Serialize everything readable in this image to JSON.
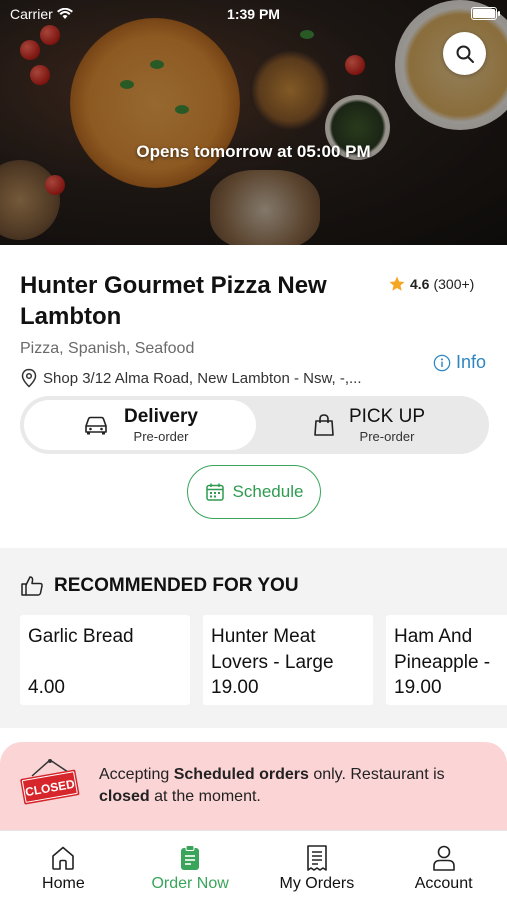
{
  "status_bar": {
    "carrier": "Carrier",
    "time": "1:39 PM"
  },
  "hero": {
    "opening_notice": "Opens tomorrow at 05:00 PM"
  },
  "restaurant": {
    "name": "Hunter Gourmet Pizza New Lambton",
    "rating": "4.6",
    "rating_count": "(300+)",
    "cuisines": "Pizza, Spanish, Seafood",
    "address": "Shop 3/12 Alma Road, New Lambton - Nsw, -,...",
    "info_label": "Info"
  },
  "order_type": {
    "options": [
      {
        "label": "Delivery",
        "sub": "Pre-order",
        "selected": true
      },
      {
        "label": "PICK UP",
        "sub": "Pre-order",
        "selected": false
      }
    ]
  },
  "schedule_label": "Schedule",
  "recommended": {
    "title": "RECOMMENDED FOR YOU",
    "items": [
      {
        "name": "Garlic Bread",
        "price": "4.00"
      },
      {
        "name": "Hunter Meat\nLovers - Large",
        "price": "19.00"
      },
      {
        "name": "Ham And\nPineapple -",
        "price": "19.00"
      }
    ]
  },
  "closed_banner": {
    "sign_text": "CLOSED",
    "part1": "Accepting ",
    "bold1": "Scheduled orders",
    "part2": " only. Restaurant is ",
    "bold2": "closed",
    "part3": " at the moment."
  },
  "tabs": [
    {
      "label": "Home",
      "icon": "home-icon",
      "active": false
    },
    {
      "label": "Order Now",
      "icon": "order-icon",
      "active": true
    },
    {
      "label": "My Orders",
      "icon": "receipt-icon",
      "active": false
    },
    {
      "label": "Account",
      "icon": "person-icon",
      "active": false
    }
  ],
  "colors": {
    "accent": "#3aa55a",
    "info": "#2e86c1",
    "closed_bg": "#fbd4d6",
    "star": "#f5a623"
  }
}
